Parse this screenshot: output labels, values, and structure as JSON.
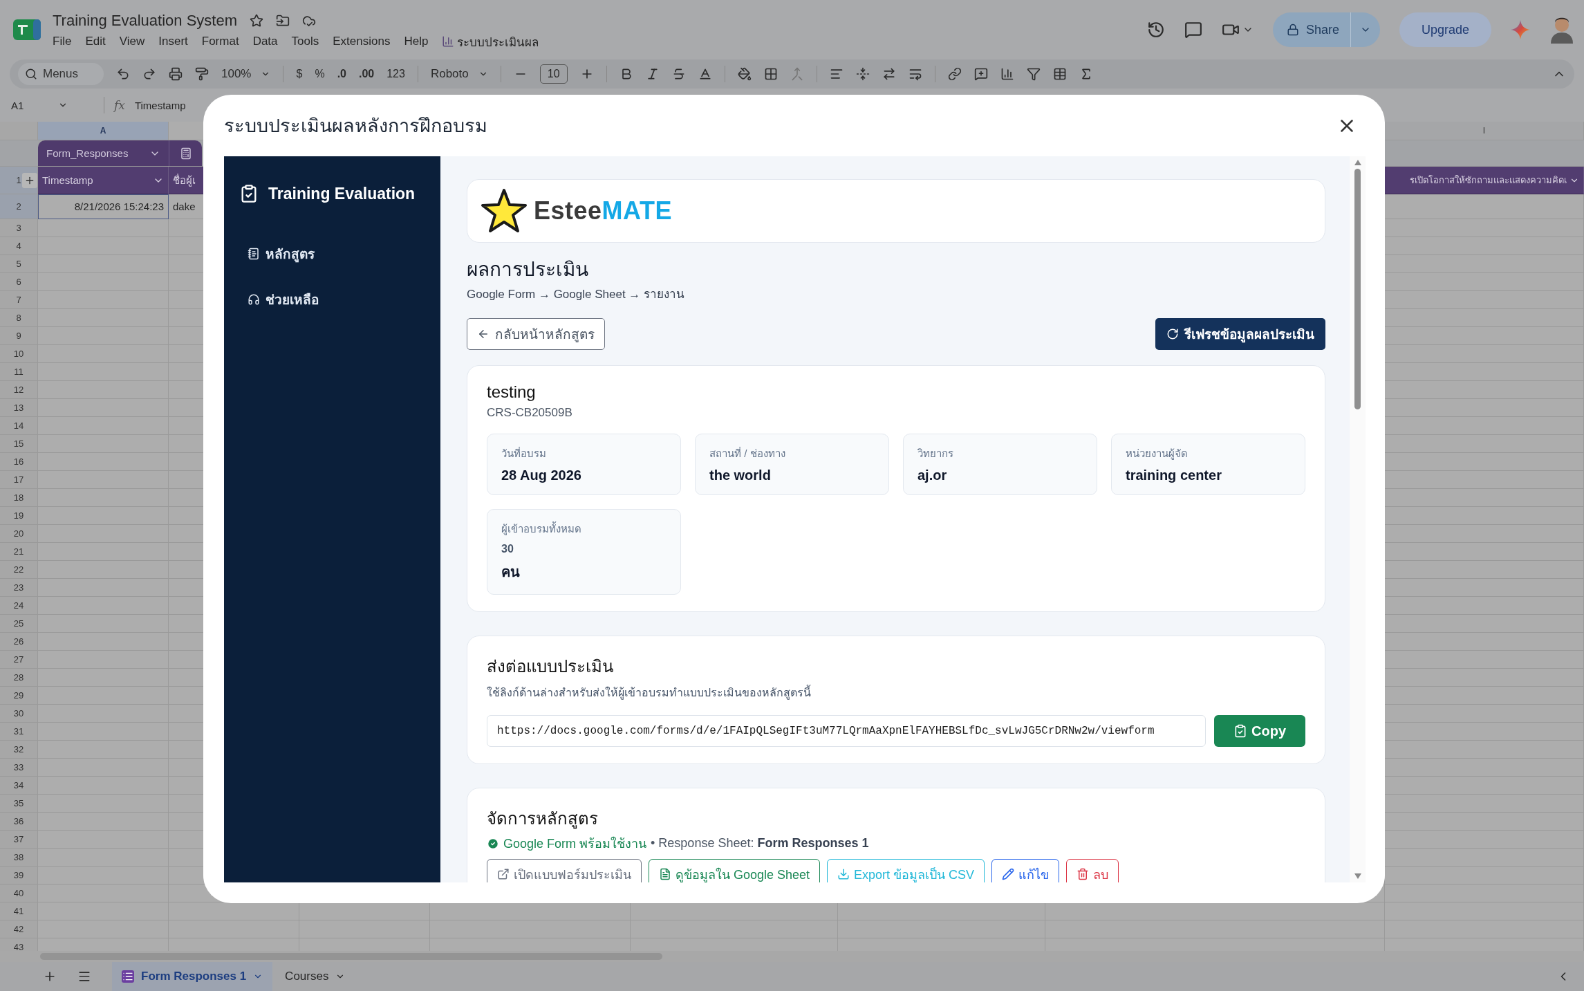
{
  "app": {
    "title": "Training Evaluation System",
    "menus": [
      "File",
      "Edit",
      "View",
      "Insert",
      "Format",
      "Data",
      "Tools",
      "Extensions",
      "Help"
    ],
    "addon_menu": "ระบบประเมินผล",
    "share": "Share",
    "upgrade": "Upgrade"
  },
  "toolbar": {
    "search": {
      "placeholder": "Menus"
    },
    "zoom": "100%",
    "currency": "$",
    "percent": "%",
    "decrease_decimals": ".0",
    "increase_decimals": ".00",
    "number_format": "123",
    "font": "Roboto",
    "font_size": "10"
  },
  "formula_bar": {
    "cell": "A1",
    "fx": "fx",
    "value": "Timestamp"
  },
  "sheet": {
    "column_headers": [
      {
        "label": "A",
        "selected": true
      },
      {
        "label": "I",
        "selected": false
      }
    ],
    "table_name": "Form_Responses",
    "header_cells": [
      "Timestamp",
      "ชื่อผู้เ",
      "รเปิดโอกาสให้ซักถามและแสดงความคิดเ"
    ],
    "row_numbers": [
      "1",
      "2",
      "3",
      "4",
      "5",
      "6",
      "7",
      "8",
      "9",
      "10",
      "11",
      "12",
      "13",
      "14",
      "15",
      "16",
      "17",
      "18",
      "19",
      "20",
      "21",
      "22",
      "23",
      "24",
      "25",
      "26",
      "27",
      "28",
      "29",
      "30",
      "31",
      "32",
      "33",
      "34",
      "35",
      "36",
      "37",
      "38",
      "39",
      "40",
      "41",
      "42",
      "43"
    ],
    "rows": [
      [
        "8/21/2026 15:24:23",
        "dake"
      ]
    ],
    "tabs": [
      {
        "label": "Form Responses 1",
        "selected": true
      },
      {
        "label": "Courses",
        "selected": false
      }
    ]
  },
  "modal": {
    "title": "ระบบประเมินผลหลังการฝึกอบรม",
    "sidebar": {
      "brand": "Training Evaluation",
      "items": [
        {
          "kind": "courses",
          "label": "หลักสูตร"
        },
        {
          "kind": "help",
          "label": "ช่วยเหลือ"
        }
      ]
    },
    "logo": {
      "dark": "Estee",
      "accent": "MATE"
    },
    "heading": "ผลการประเมิน",
    "subtitle": "Google Form → Google Sheet → รายงาน",
    "back_button": "กลับหน้าหลักสูตร",
    "refresh_button": "รีเฟรชข้อมูลผลประเมิน",
    "course": {
      "name": "testing",
      "code": "CRS-CB20509B",
      "info": [
        {
          "kind": "field",
          "label": "วันที่อบรม",
          "value": "28 Aug 2026"
        },
        {
          "kind": "field",
          "label": "สถานที่ / ช่องทาง",
          "value": "the world"
        },
        {
          "kind": "field",
          "label": "วิทยากร",
          "value": "aj.or"
        },
        {
          "kind": "field",
          "label": "หน่วยงานผู้จัด",
          "value": "training center"
        },
        {
          "kind": "count",
          "label": "ผู้เข้าอบรมทั้งหมด",
          "value": "30",
          "unit": "คน"
        }
      ]
    },
    "share": {
      "title": "ส่งต่อแบบประเมิน",
      "description": "ใช้ลิงก์ด้านล่างสำหรับส่งให้ผู้เข้าอบรมทำแบบประเมินของหลักสูตรนี้",
      "link": "https://docs.google.com/forms/d/e/1FAIpQLSegIFt3uM77LQrmAaXpnElFAYHEBSLfDc_svLwJG5CrDRNw2w/viewform",
      "copy": "Copy"
    },
    "manage": {
      "title": "จัดการหลักสูตร",
      "status": "Google Form พร้อมใช้งาน",
      "detail": "• Response Sheet: **Form Responses 1**",
      "buttons": [
        {
          "kind": "open",
          "label": "เปิดแบบฟอร์มประเมิน"
        },
        {
          "kind": "sheet",
          "label": "ดูข้อมูลใน Google Sheet"
        },
        {
          "kind": "export",
          "label": "Export ข้อมูลเป็น CSV"
        },
        {
          "kind": "edit",
          "label": "แก้ไข"
        },
        {
          "kind": "delete",
          "label": "ลบ"
        }
      ]
    }
  }
}
